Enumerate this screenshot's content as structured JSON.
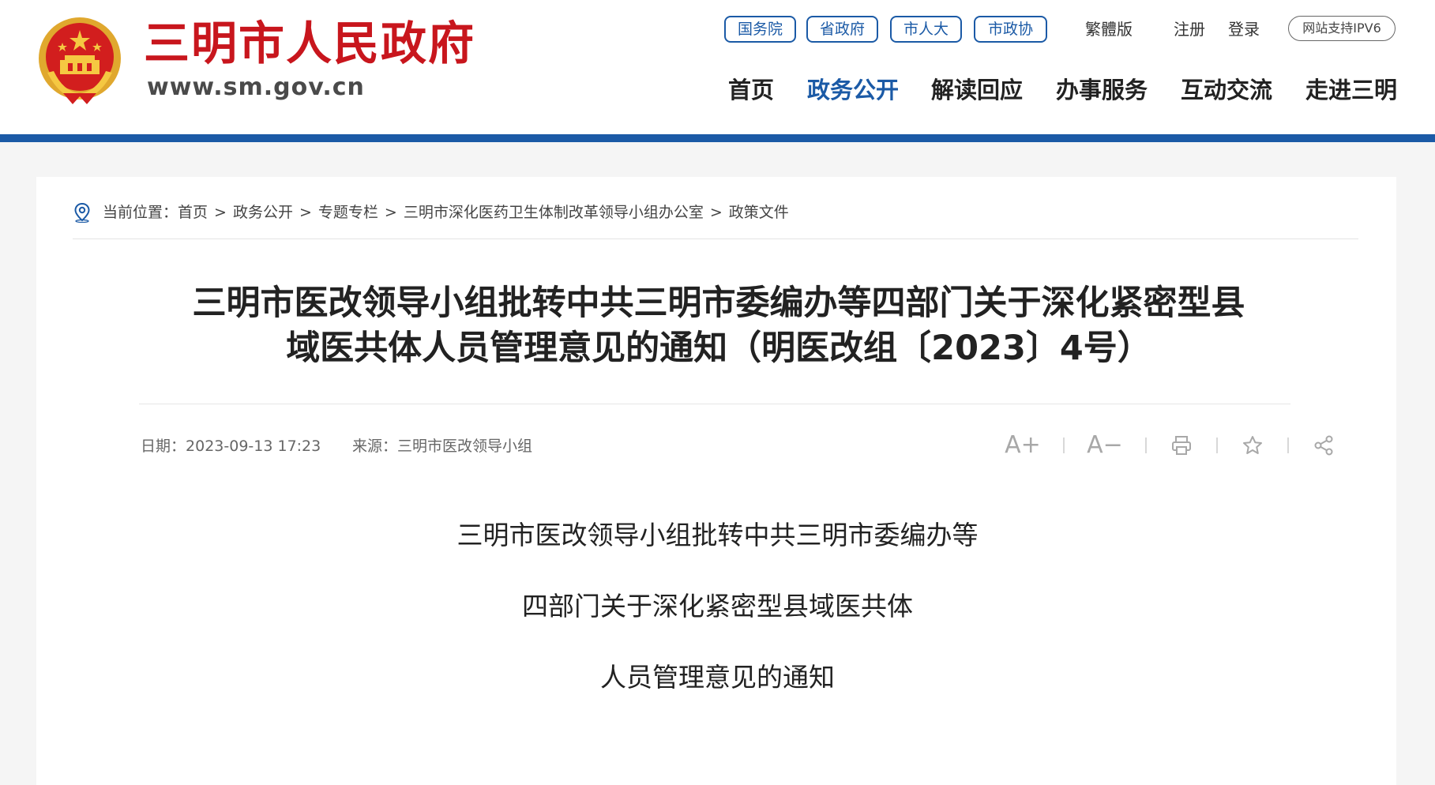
{
  "header": {
    "site_name": "三明市人民政府",
    "site_url": "www.sm.gov.cn",
    "top_links": [
      "国务院",
      "省政府",
      "市人大",
      "市政协"
    ],
    "traditional_label": "繁體版",
    "register_label": "注册",
    "login_label": "登录",
    "ipv6_label": "网站支持IPV6",
    "nav": [
      {
        "label": "首页",
        "active": false
      },
      {
        "label": "政务公开",
        "active": true
      },
      {
        "label": "解读回应",
        "active": false
      },
      {
        "label": "办事服务",
        "active": false
      },
      {
        "label": "互动交流",
        "active": false
      },
      {
        "label": "走进三明",
        "active": false
      }
    ]
  },
  "breadcrumb": {
    "prefix": "当前位置：",
    "separator": ">",
    "items": [
      "首页",
      "政务公开",
      "专题专栏",
      "三明市深化医药卫生体制改革领导小组办公室",
      "政策文件"
    ]
  },
  "article": {
    "title_line1": "三明市医改领导小组批转中共三明市委编办等四部门关于深化紧密型县",
    "title_line2": "域医共体人员管理意见的通知（明医改组〔2023〕4号）",
    "date_label": "日期：",
    "date": "2023-09-13 17:23",
    "source_label": "来源：",
    "source": "三明市医改领导小组",
    "tools": {
      "font_increase": "A+",
      "font_decrease": "A−"
    },
    "doc_title_lines": [
      "三明市医改领导小组批转中共三明市委编办等",
      "四部门关于深化紧密型县域医共体",
      "人员管理意见的通知"
    ]
  },
  "colors": {
    "brand_red": "#c8161d",
    "brand_blue": "#1b5aa6"
  },
  "icons": [
    "national-emblem-icon",
    "location-pin-icon",
    "print-icon",
    "star-icon",
    "share-icon"
  ]
}
